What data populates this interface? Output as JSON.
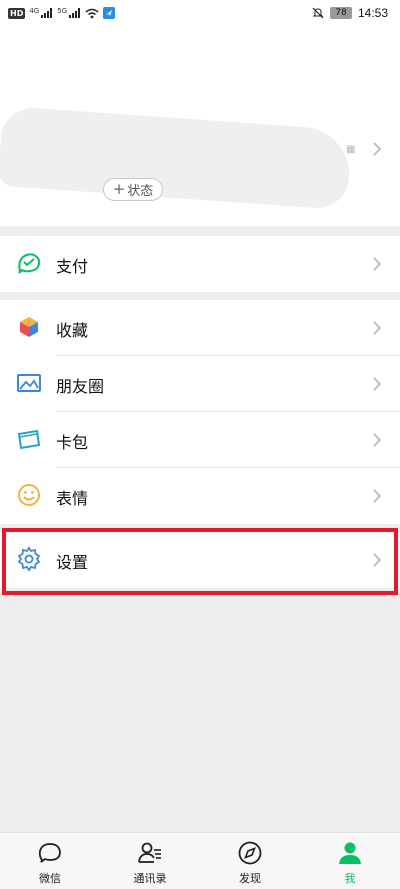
{
  "status_bar": {
    "hd_badge": "HD",
    "net1": "4G",
    "net2": "5G",
    "battery": "78",
    "time": "14:53"
  },
  "profile": {
    "status_button": "状态",
    "status_plus": "+"
  },
  "menu": {
    "pay": "支付",
    "favorites": "收藏",
    "moments": "朋友圈",
    "cards": "卡包",
    "stickers": "表情",
    "settings": "设置"
  },
  "tabbar": {
    "items": [
      {
        "label": "微信",
        "icon": "chat-bubble-icon",
        "active": false
      },
      {
        "label": "通讯录",
        "icon": "contacts-icon",
        "active": false
      },
      {
        "label": "发现",
        "icon": "compass-icon",
        "active": false
      },
      {
        "label": "我",
        "icon": "person-icon",
        "active": true
      }
    ]
  },
  "colors": {
    "accent": "#07c160",
    "highlight": "#e21b2c",
    "background": "#ededed"
  }
}
